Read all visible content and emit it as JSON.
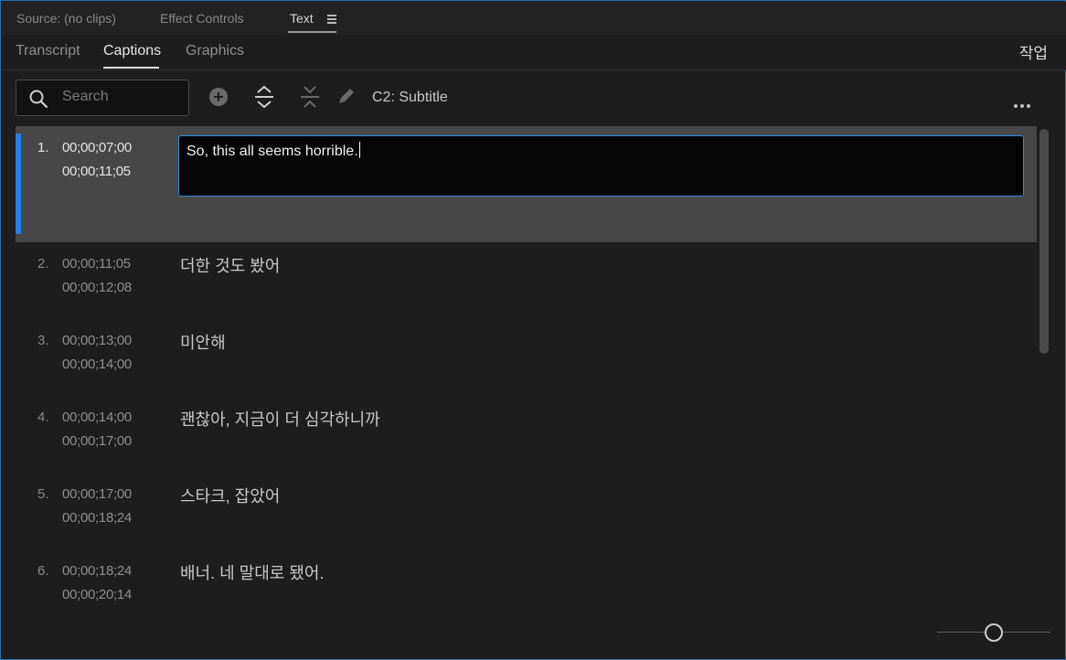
{
  "colors": {
    "accent": "#2680eb",
    "background": "#1d1d1d",
    "selected_row": "#474747"
  },
  "panel_tabs": [
    {
      "label": "Source: (no clips)",
      "active": false
    },
    {
      "label": "Effect Controls",
      "active": false
    },
    {
      "label": "Text",
      "active": true
    }
  ],
  "subtabs": [
    {
      "label": "Transcript",
      "active": false
    },
    {
      "label": "Captions",
      "active": true
    },
    {
      "label": "Graphics",
      "active": false
    }
  ],
  "workspace_label": "작업",
  "toolbar": {
    "search_placeholder": "Search",
    "track_label": "C2: Subtitle",
    "icons": [
      "search-icon",
      "add-caption-icon",
      "split-caption-icon",
      "merge-captions-icon",
      "pencil-icon",
      "more-icon"
    ]
  },
  "captions": [
    {
      "num": "1.",
      "in": "00;00;07;00",
      "out": "00;00;11;05",
      "text": "So, this all seems horrible.",
      "selected": true
    },
    {
      "num": "2.",
      "in": "00;00;11;05",
      "out": "00;00;12;08",
      "text": "더한 것도 봤어",
      "selected": false
    },
    {
      "num": "3.",
      "in": "00;00;13;00",
      "out": "00;00;14;00",
      "text": "미안해",
      "selected": false
    },
    {
      "num": "4.",
      "in": "00;00;14;00",
      "out": "00;00;17;00",
      "text": "괜찮아, 지금이 더 심각하니까",
      "selected": false
    },
    {
      "num": "5.",
      "in": "00;00;17;00",
      "out": "00;00;18;24",
      "text": "스타크, 잡았어",
      "selected": false
    },
    {
      "num": "6.",
      "in": "00;00;18;24",
      "out": "00;00;20;14",
      "text": "배너. 네 말대로 됐어.",
      "selected": false
    }
  ],
  "zoom_level": 0.5
}
